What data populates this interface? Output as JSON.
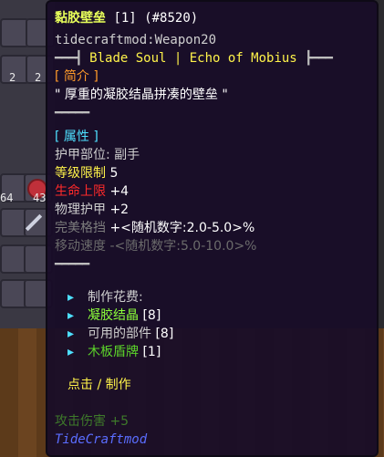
{
  "item": {
    "name": "黏胶壁垒",
    "stack": "[1]",
    "id": "(#8520)",
    "internal": "tidecraftmod:Weapon20",
    "banner_left": "━━━┫",
    "banner_text": "Blade Soul | Echo of Mobius",
    "banner_right": "┣━━━",
    "intro_header": "[ 简介 ]",
    "intro_text": "\" 厚重的凝胶结晶拼凑的壁垒 \"",
    "sep": "━━━━━",
    "attr_header": "[ 属性 ]",
    "slot_label": "护甲部位: 副手",
    "level_label": "等级限制",
    "level_value": "5",
    "life_label": "生命上限",
    "life_value": "+4",
    "defense_label": "物理护甲",
    "defense_value": "+2",
    "perfect_label": "完美格挡",
    "perfect_value": "+<随机数字:2.0-5.0>%",
    "speed_label": "移动速度",
    "speed_value": "-<随机数字:5.0-10.0>%",
    "craft_header": "制作花费:",
    "craft_items": [
      {
        "name": "凝胶结晶",
        "count": "[8]"
      },
      {
        "name": "可用的部件",
        "count": "[8]"
      },
      {
        "name": "木板盾牌",
        "count": "[1]"
      }
    ],
    "craft_action": "点击 / 制作",
    "attack_faded": "攻击伤害 +5",
    "mod_name": "TideCraftmod"
  },
  "background": {
    "counts": [
      "2",
      "2",
      "64",
      "43"
    ]
  },
  "colors": {
    "title": "#e8ff5a",
    "banner": "#fff34a",
    "header": "#ff9b2a",
    "attr": "#4ee0ff",
    "life": "#ff2a2a",
    "crafted": "#8cff3a",
    "mod": "#5a6dff"
  }
}
